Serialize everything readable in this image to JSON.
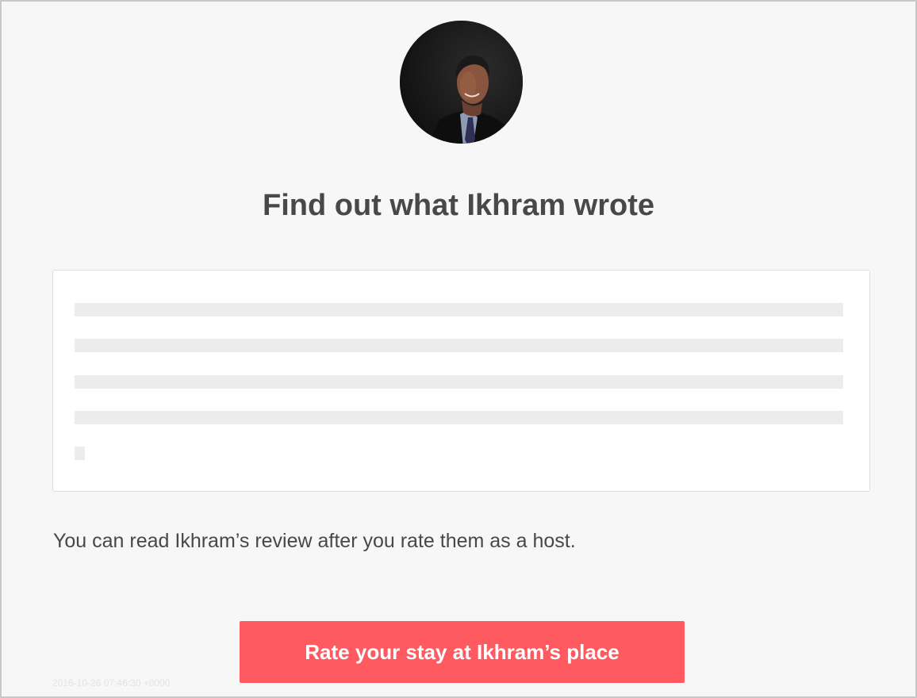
{
  "header": {
    "avatar_icon": "host-profile-photo"
  },
  "main": {
    "title": "Find out what Ikhram wrote",
    "notice": "You can read Ikhram’s review after you rate them as a host.",
    "cta_label": "Rate your stay at Ikhram’s place"
  },
  "footer": {
    "timestamp": "2016-10-26 07:46:30 +0000"
  },
  "colors": {
    "background": "#f7f7f7",
    "text": "#484848",
    "accent": "#ff5a5f",
    "blur_placeholder": "#ececec"
  }
}
